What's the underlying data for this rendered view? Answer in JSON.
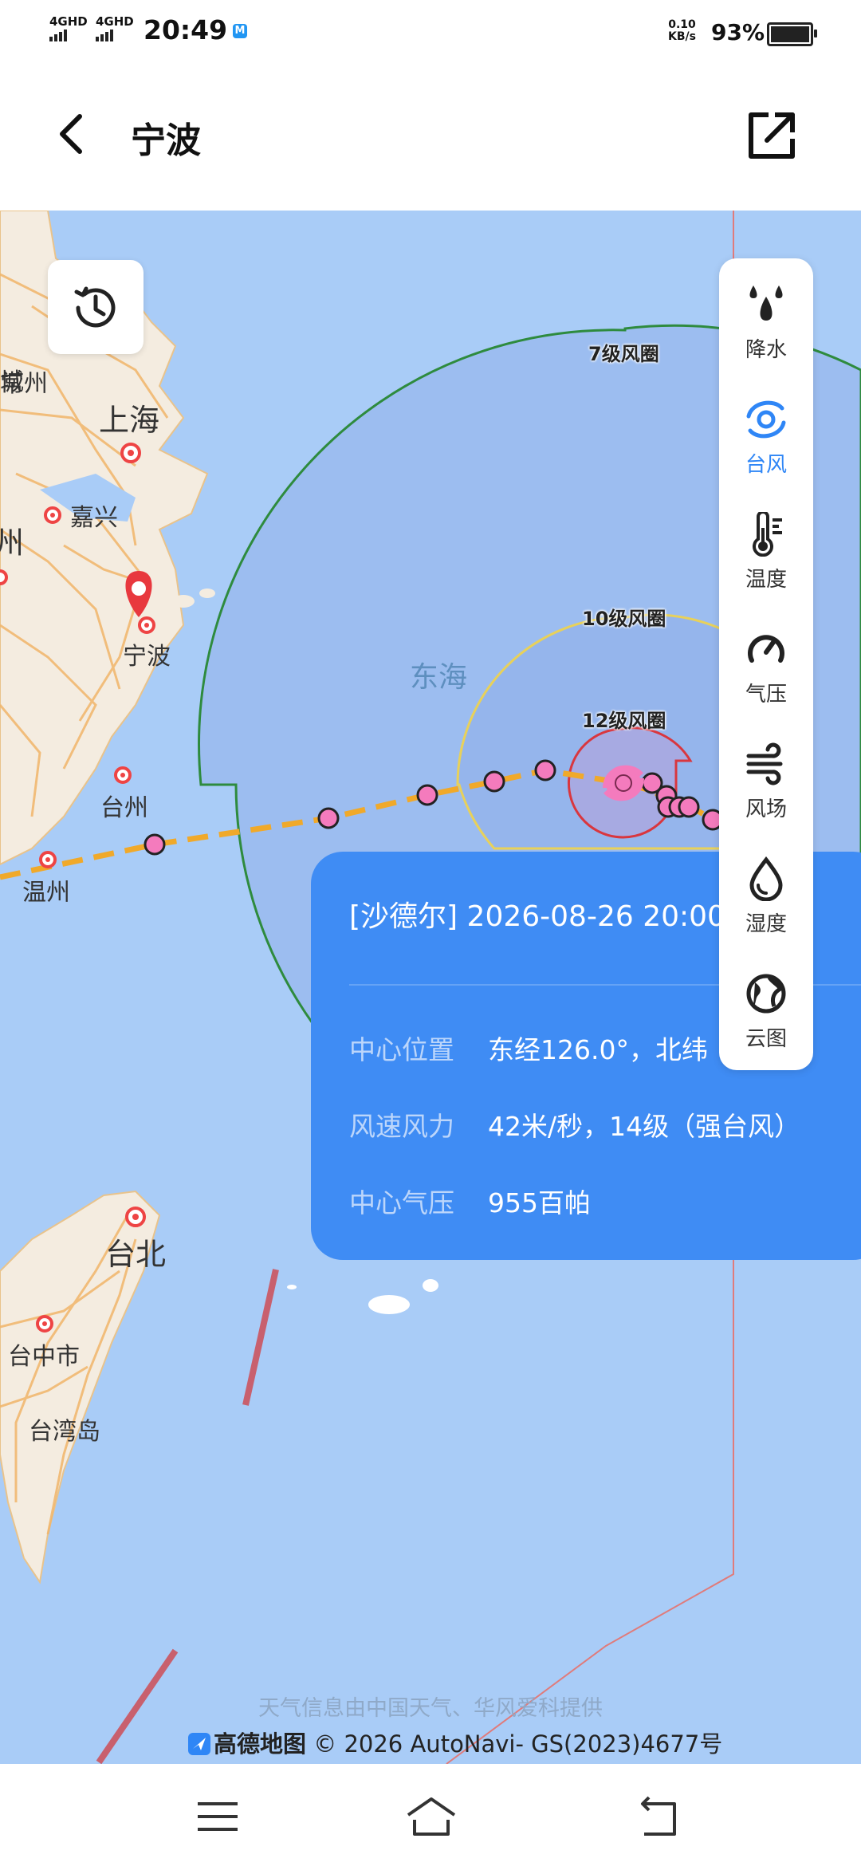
{
  "status_bar": {
    "signal1": "4GHD",
    "signal2": "4GHD",
    "time": "20:49",
    "network_speed": "0.10",
    "network_unit": "KB/s",
    "battery_percent": "93%",
    "battery_level": 0.93
  },
  "header": {
    "title": "宁波"
  },
  "map": {
    "cities": {
      "changzhou": "常州",
      "shanghai": "上海",
      "jiaxing": "嘉兴",
      "hangzhou": "州",
      "ningbo": "宁波",
      "taizhou": "台州",
      "wenzhou": "温州",
      "taipei": "台北",
      "taichung": "台中市",
      "taiwan_island": "台湾岛",
      "top_left": "城"
    },
    "sea": "东海",
    "rings": {
      "r7": "7级风圈",
      "r10": "10级风圈",
      "r12": "12级风圈"
    },
    "colors": {
      "ring7": "#2e8b3e",
      "ring10": "#e8d15a",
      "ring12": "#d9363e",
      "track": "#f0a92a",
      "track_point": "#f47bbd",
      "border_line": "#e07b7b"
    }
  },
  "layers": [
    {
      "label": "降水",
      "icon": "rain-icon"
    },
    {
      "label": "台风",
      "icon": "typhoon-icon",
      "active": true
    },
    {
      "label": "温度",
      "icon": "thermometer-icon"
    },
    {
      "label": "气压",
      "icon": "gauge-icon"
    },
    {
      "label": "风场",
      "icon": "wind-icon"
    },
    {
      "label": "湿度",
      "icon": "humidity-icon"
    },
    {
      "label": "云图",
      "icon": "globe-icon"
    }
  ],
  "card": {
    "title": "[沙德尔] 2026-08-26 20:00",
    "rows": [
      {
        "key": "中心位置",
        "value": "东经126.0°，北纬"
      },
      {
        "key": "风速风力",
        "value": "42米/秒，14级（强台风）"
      },
      {
        "key": "中心气压",
        "value": "955百帕"
      }
    ]
  },
  "attribution": "天气信息由中国天气、华风爱科提供",
  "copyright": {
    "brand": "高德地图",
    "text": "© 2026 AutoNavi- GS(2023)4677号"
  }
}
